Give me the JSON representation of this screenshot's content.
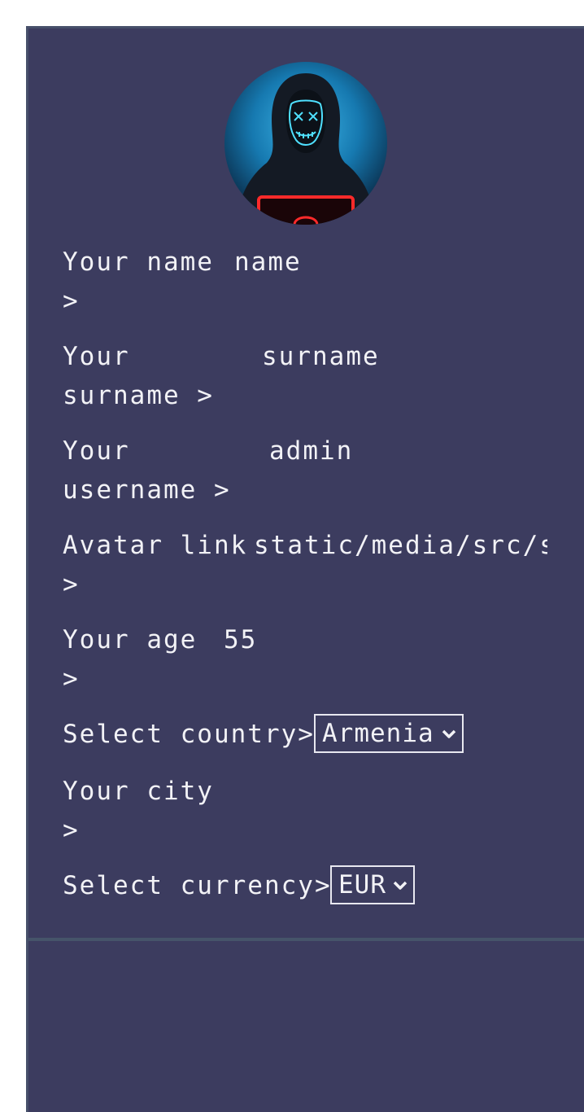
{
  "form": {
    "fields": [
      {
        "label_line1": "Your name",
        "value": "name",
        "label_line2": ">"
      },
      {
        "label_line1": "Your",
        "value": "surname",
        "label_line2": "surname >"
      },
      {
        "label_line1": "Your",
        "value": "admin",
        "label_line2": "username >"
      },
      {
        "label_line1": "Avatar link",
        "value": "static/media/src/sl",
        "label_line2": ">"
      },
      {
        "label_line1": "Your age",
        "value": "55",
        "label_line2": ">"
      }
    ],
    "country": {
      "label": "Select country>",
      "selected": "Armenia"
    },
    "city": {
      "label_line1": "Your city",
      "value": "",
      "label_line2": ">"
    },
    "currency": {
      "label": "Select currency>",
      "selected": "EUR"
    }
  },
  "avatar": {
    "icon": "hooded-hacker-avatar"
  },
  "colors": {
    "panel_bg": "#3c3c5f",
    "text": "#f2f2f6",
    "divider": "#46546a"
  }
}
